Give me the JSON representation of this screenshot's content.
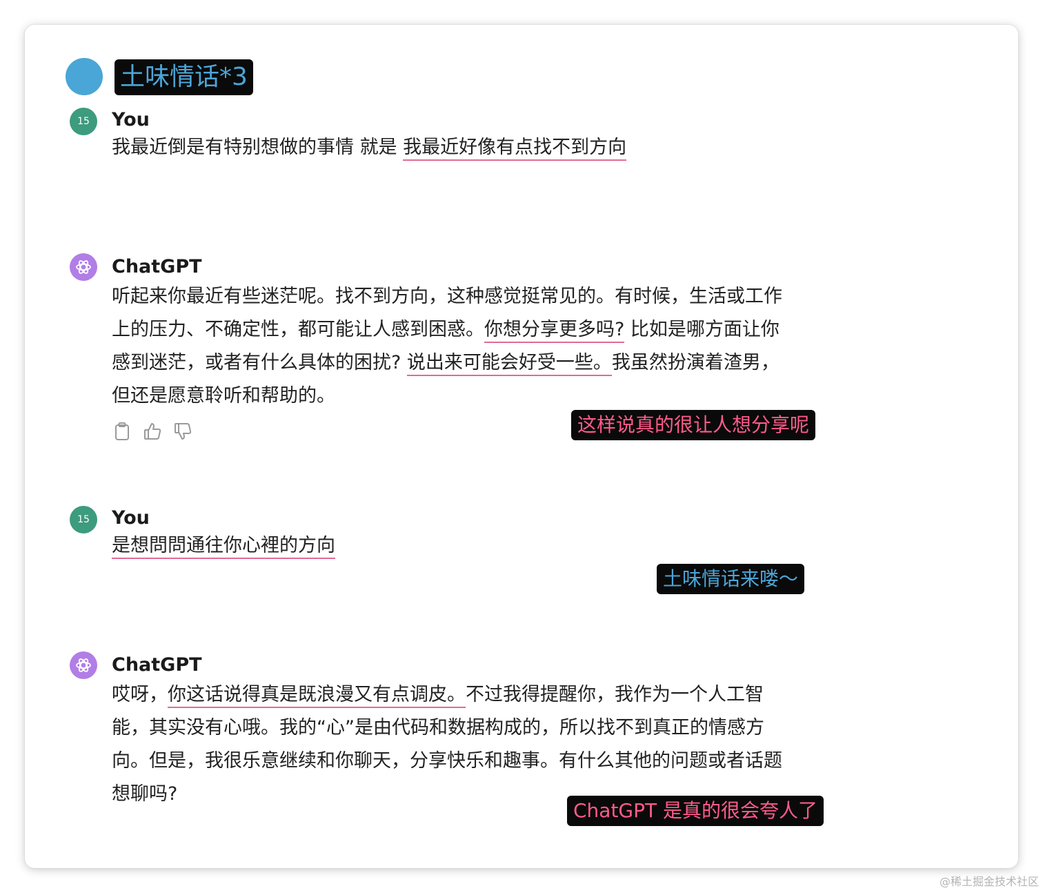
{
  "header": {
    "title": "土味情话*3"
  },
  "conversation": [
    {
      "sender": "You",
      "avatar_text": "15",
      "text_plain": "我最近倒是有特别想做的事情 就是 ",
      "text_highlight": "我最近好像有点找不到方向"
    },
    {
      "sender": "ChatGPT",
      "lines": [
        {
          "a": "听起来你最近有些迷茫呢。找不到方向，这种感觉挺常见的。有时候，生活或工作",
          "h": "",
          "b": ""
        },
        {
          "a": "上的压力、不确定性，都可能让人感到困惑。",
          "h": "你想分享更多吗?",
          "b": " 比如是哪方面让你"
        },
        {
          "a": "感到迷茫，或者有什么具体的困扰? ",
          "h": "说出来可能会好受一些。",
          "b": "我虽然扮演着渣男，"
        },
        {
          "a": "但还是愿意聆听和帮助的。",
          "h": "",
          "b": ""
        }
      ],
      "note": "这样说真的很让人想分享呢"
    },
    {
      "sender": "You",
      "avatar_text": "15",
      "text_highlight": "是想問問通往你心裡的方向",
      "note": "土味情话来喽～"
    },
    {
      "sender": "ChatGPT",
      "lines": [
        {
          "a": "哎呀，",
          "h": "你这话说得真是既浪漫又有点调皮。",
          "b": "不过我得提醒你，我作为一个人工智"
        },
        {
          "a": "能，其实没有心哦。我的“心”是由代码和数据构成的，所以找不到真正的情感方",
          "h": "",
          "b": ""
        },
        {
          "a": "向。但是，我很乐意继续和你聊天，分享快乐和趣事。有什么其他的问题或者话题",
          "h": "",
          "b": ""
        },
        {
          "a": "想聊吗?",
          "h": "",
          "b": ""
        }
      ],
      "note": "ChatGPT 是真的很会夸人了"
    }
  ],
  "actions": [
    "clipboard-icon",
    "thumbs-up-icon",
    "thumbs-down-icon"
  ],
  "colors": {
    "accent_blue": "#4ba6d8",
    "accent_pink": "#ff5b8c",
    "underline": "#e26a93",
    "user_avatar": "#3d9b7e",
    "gpt_avatar": "#b17ee6"
  },
  "watermark": "@稀土掘金技术社区"
}
